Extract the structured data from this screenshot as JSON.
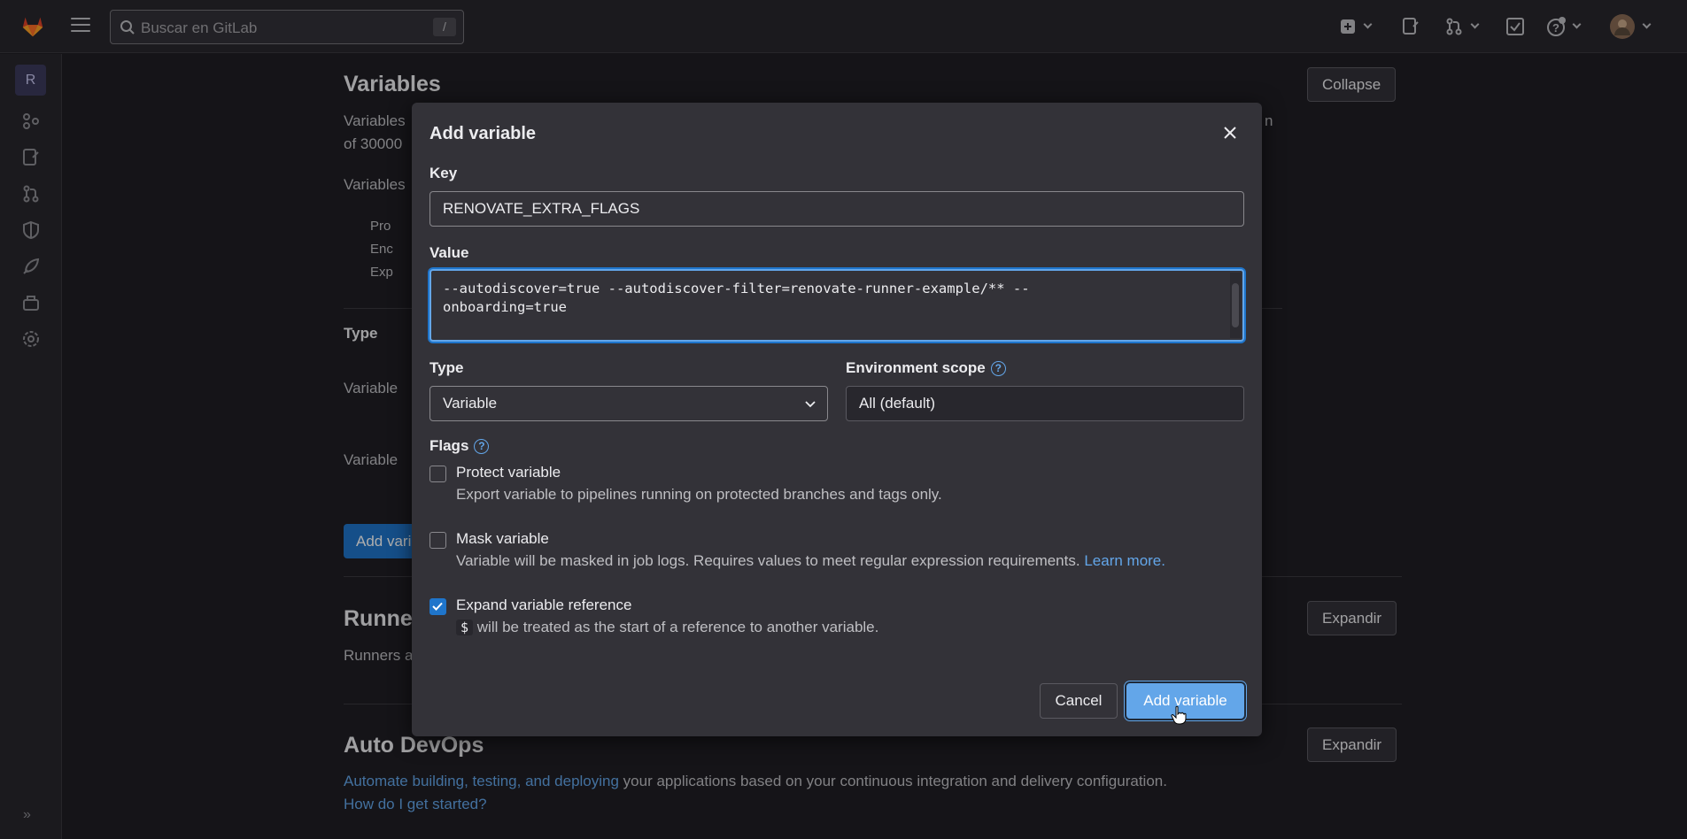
{
  "topbar": {
    "search_placeholder": "Buscar en GitLab",
    "search_shortcut": "/"
  },
  "rail": {
    "project_letter": "R"
  },
  "background": {
    "variables_title": "Variables",
    "collapse_label": "Collapse",
    "desc_line1": "Variables",
    "desc_line1_end": "n",
    "desc_line2": "of 30000",
    "desc_line3": "Variables",
    "bullets": [
      "Pro",
      "Enc",
      "Exp"
    ],
    "type_header": "Type",
    "row_labels": [
      "Variable",
      "Variable"
    ],
    "add_button_partial": "Add vari",
    "runners_title": "Runne",
    "runners_desc": "Runners a",
    "expand_label": "Expandir",
    "autodevops_title": "Auto DevOps",
    "autodevops_link": "Automate building, testing, and deploying",
    "autodevops_text": " your applications based on your continuous integration and delivery configuration.",
    "autodevops_help": "How do I get started?"
  },
  "modal": {
    "title": "Add variable",
    "key_label": "Key",
    "key_value": "RENOVATE_EXTRA_FLAGS",
    "value_label": "Value",
    "value_text": "--autodiscover=true --autodiscover-filter=renovate-runner-example/** --\nonboarding=true",
    "type_label": "Type",
    "type_selected": "Variable",
    "env_label": "Environment scope",
    "env_value": "All (default)",
    "flags_label": "Flags",
    "help_glyph": "?",
    "flags": [
      {
        "label": "Protect variable",
        "help": "Export variable to pipelines running on protected branches and tags only.",
        "checked": false
      },
      {
        "label": "Mask variable",
        "help": "Variable will be masked in job logs. Requires values to meet regular expression requirements.",
        "link": "Learn more.",
        "checked": false
      },
      {
        "label": "Expand variable reference",
        "code": "$",
        "help": "will be treated as the start of a reference to another variable.",
        "checked": true
      }
    ],
    "cancel_label": "Cancel",
    "submit_label": "Add variable"
  },
  "colors": {
    "accent": "#1f75cb",
    "link": "#63a6e9",
    "background": "#1f1e24",
    "modal": "#333238"
  },
  "icons": [
    "gitlab-logo-icon",
    "hamburger-icon",
    "search-icon",
    "plus-square-icon",
    "issues-icon",
    "merge-request-icon",
    "todo-check-icon",
    "help-icon",
    "user-avatar",
    "close-icon",
    "chevron-down-icon",
    "check-icon",
    "cursor-hand-icon"
  ]
}
